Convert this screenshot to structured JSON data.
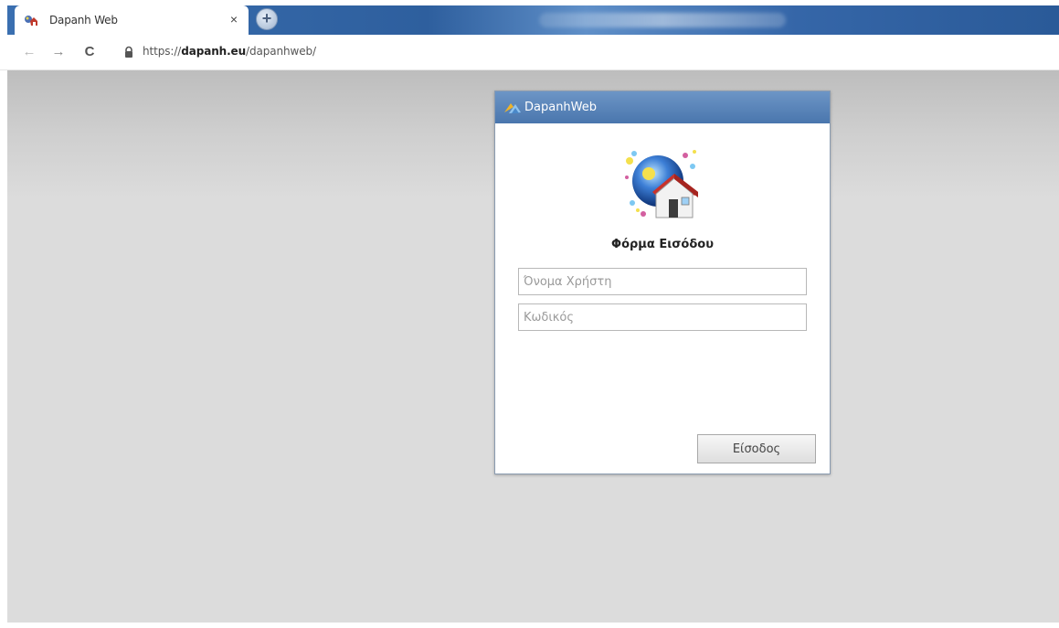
{
  "browser": {
    "tab": {
      "title": "Dapanh Web",
      "close_symbol": "×",
      "favicon_icon": "dapanh-favicon-icon"
    },
    "new_tab_symbol": "+",
    "nav": {
      "back_symbol": "←",
      "forward_symbol": "→",
      "reload_symbol": "C"
    },
    "address": {
      "scheme": "https://",
      "host": "dapanh.eu",
      "path": "/dapanhweb/",
      "lock_icon": "lock-icon"
    }
  },
  "login_panel": {
    "header_title": "DapanhWeb",
    "header_icon": "dapanh-logo-icon",
    "logo_icon": "globe-house-logo-icon",
    "form_title": "Φόρμα Εισόδου",
    "username": {
      "value": "",
      "placeholder": "Όνομα Χρήστη"
    },
    "password": {
      "value": "",
      "placeholder": "Κωδικός"
    },
    "submit_label": "Είσοδος"
  },
  "colors": {
    "tabstrip_blue": "#3a6fb0",
    "panel_header_top": "#6d95c6",
    "panel_header_bottom": "#4a76ad",
    "page_background": "#dcdcdc"
  }
}
